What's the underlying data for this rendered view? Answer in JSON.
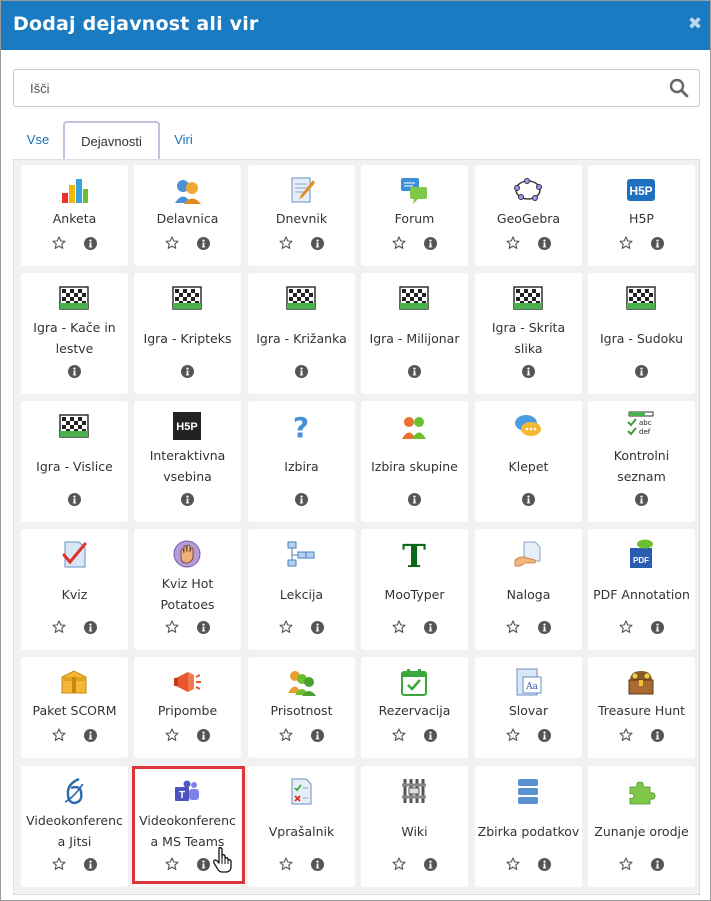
{
  "dialog": {
    "title": "Dodaj dejavnost ali vir",
    "close_icon": "close-icon"
  },
  "search": {
    "placeholder": "Išči",
    "icon": "search-icon"
  },
  "tabs": [
    {
      "label": "Vse",
      "active": false
    },
    {
      "label": "Dejavnosti",
      "active": true
    },
    {
      "label": "Viri",
      "active": false
    }
  ],
  "modules": [
    {
      "name": "Anketa",
      "icon": "chart-icon",
      "star": true
    },
    {
      "name": "Delavnica",
      "icon": "workshop-icon",
      "star": true
    },
    {
      "name": "Dnevnik",
      "icon": "journal-icon",
      "star": true
    },
    {
      "name": "Forum",
      "icon": "forum-icon",
      "star": true
    },
    {
      "name": "GeoGebra",
      "icon": "geogebra-icon",
      "star": true
    },
    {
      "name": "H5P",
      "icon": "h5p-icon",
      "star": true
    },
    {
      "name": "Igra - Kače in lestve",
      "icon": "game-icon",
      "star": false
    },
    {
      "name": "Igra - Kripteks",
      "icon": "game-icon",
      "star": false
    },
    {
      "name": "Igra - Križanka",
      "icon": "game-icon",
      "star": false
    },
    {
      "name": "Igra - Milijonar",
      "icon": "game-icon",
      "star": false
    },
    {
      "name": "Igra - Skrita slika",
      "icon": "game-icon",
      "star": false
    },
    {
      "name": "Igra - Sudoku",
      "icon": "game-icon",
      "star": false
    },
    {
      "name": "Igra - Vislice",
      "icon": "game-icon",
      "star": false
    },
    {
      "name": "Interaktivna vsebina",
      "icon": "h5p-dark-icon",
      "star": false
    },
    {
      "name": "Izbira",
      "icon": "question-icon",
      "star": false
    },
    {
      "name": "Izbira skupine",
      "icon": "group-choice-icon",
      "star": false
    },
    {
      "name": "Klepet",
      "icon": "chat-icon",
      "star": false
    },
    {
      "name": "Kontrolni seznam",
      "icon": "checklist-icon",
      "star": false
    },
    {
      "name": "Kviz",
      "icon": "quiz-icon",
      "star": true
    },
    {
      "name": "Kviz Hot Potatoes",
      "icon": "hotpot-icon",
      "star": true
    },
    {
      "name": "Lekcija",
      "icon": "lesson-icon",
      "star": true
    },
    {
      "name": "MooTyper",
      "icon": "mootyper-icon",
      "star": true
    },
    {
      "name": "Naloga",
      "icon": "assignment-icon",
      "star": true
    },
    {
      "name": "PDF Annotation",
      "icon": "pdf-icon",
      "star": true
    },
    {
      "name": "Paket SCORM",
      "icon": "scorm-icon",
      "star": true
    },
    {
      "name": "Pripombe",
      "icon": "feedback-icon",
      "star": true
    },
    {
      "name": "Prisotnost",
      "icon": "attendance-icon",
      "star": true
    },
    {
      "name": "Rezervacija",
      "icon": "scheduler-icon",
      "star": true
    },
    {
      "name": "Slovar",
      "icon": "glossary-icon",
      "star": true
    },
    {
      "name": "Treasure Hunt",
      "icon": "treasure-icon",
      "star": true
    },
    {
      "name": "Videokonferenc a Jitsi",
      "icon": "jitsi-icon",
      "star": true
    },
    {
      "name": "Videokonferenc a MS Teams",
      "icon": "teams-icon",
      "star": true
    },
    {
      "name": "Vprašalnik",
      "icon": "questionnaire-icon",
      "star": true
    },
    {
      "name": "Wiki",
      "icon": "wiki-icon",
      "star": true
    },
    {
      "name": "Zbirka podatkov",
      "icon": "database-icon",
      "star": true
    },
    {
      "name": "Zunanje orodje",
      "icon": "puzzle-icon",
      "star": true
    }
  ],
  "colors": {
    "header": "#1a7ac2",
    "link": "#1a6fb5",
    "highlight": "#d9373b"
  }
}
